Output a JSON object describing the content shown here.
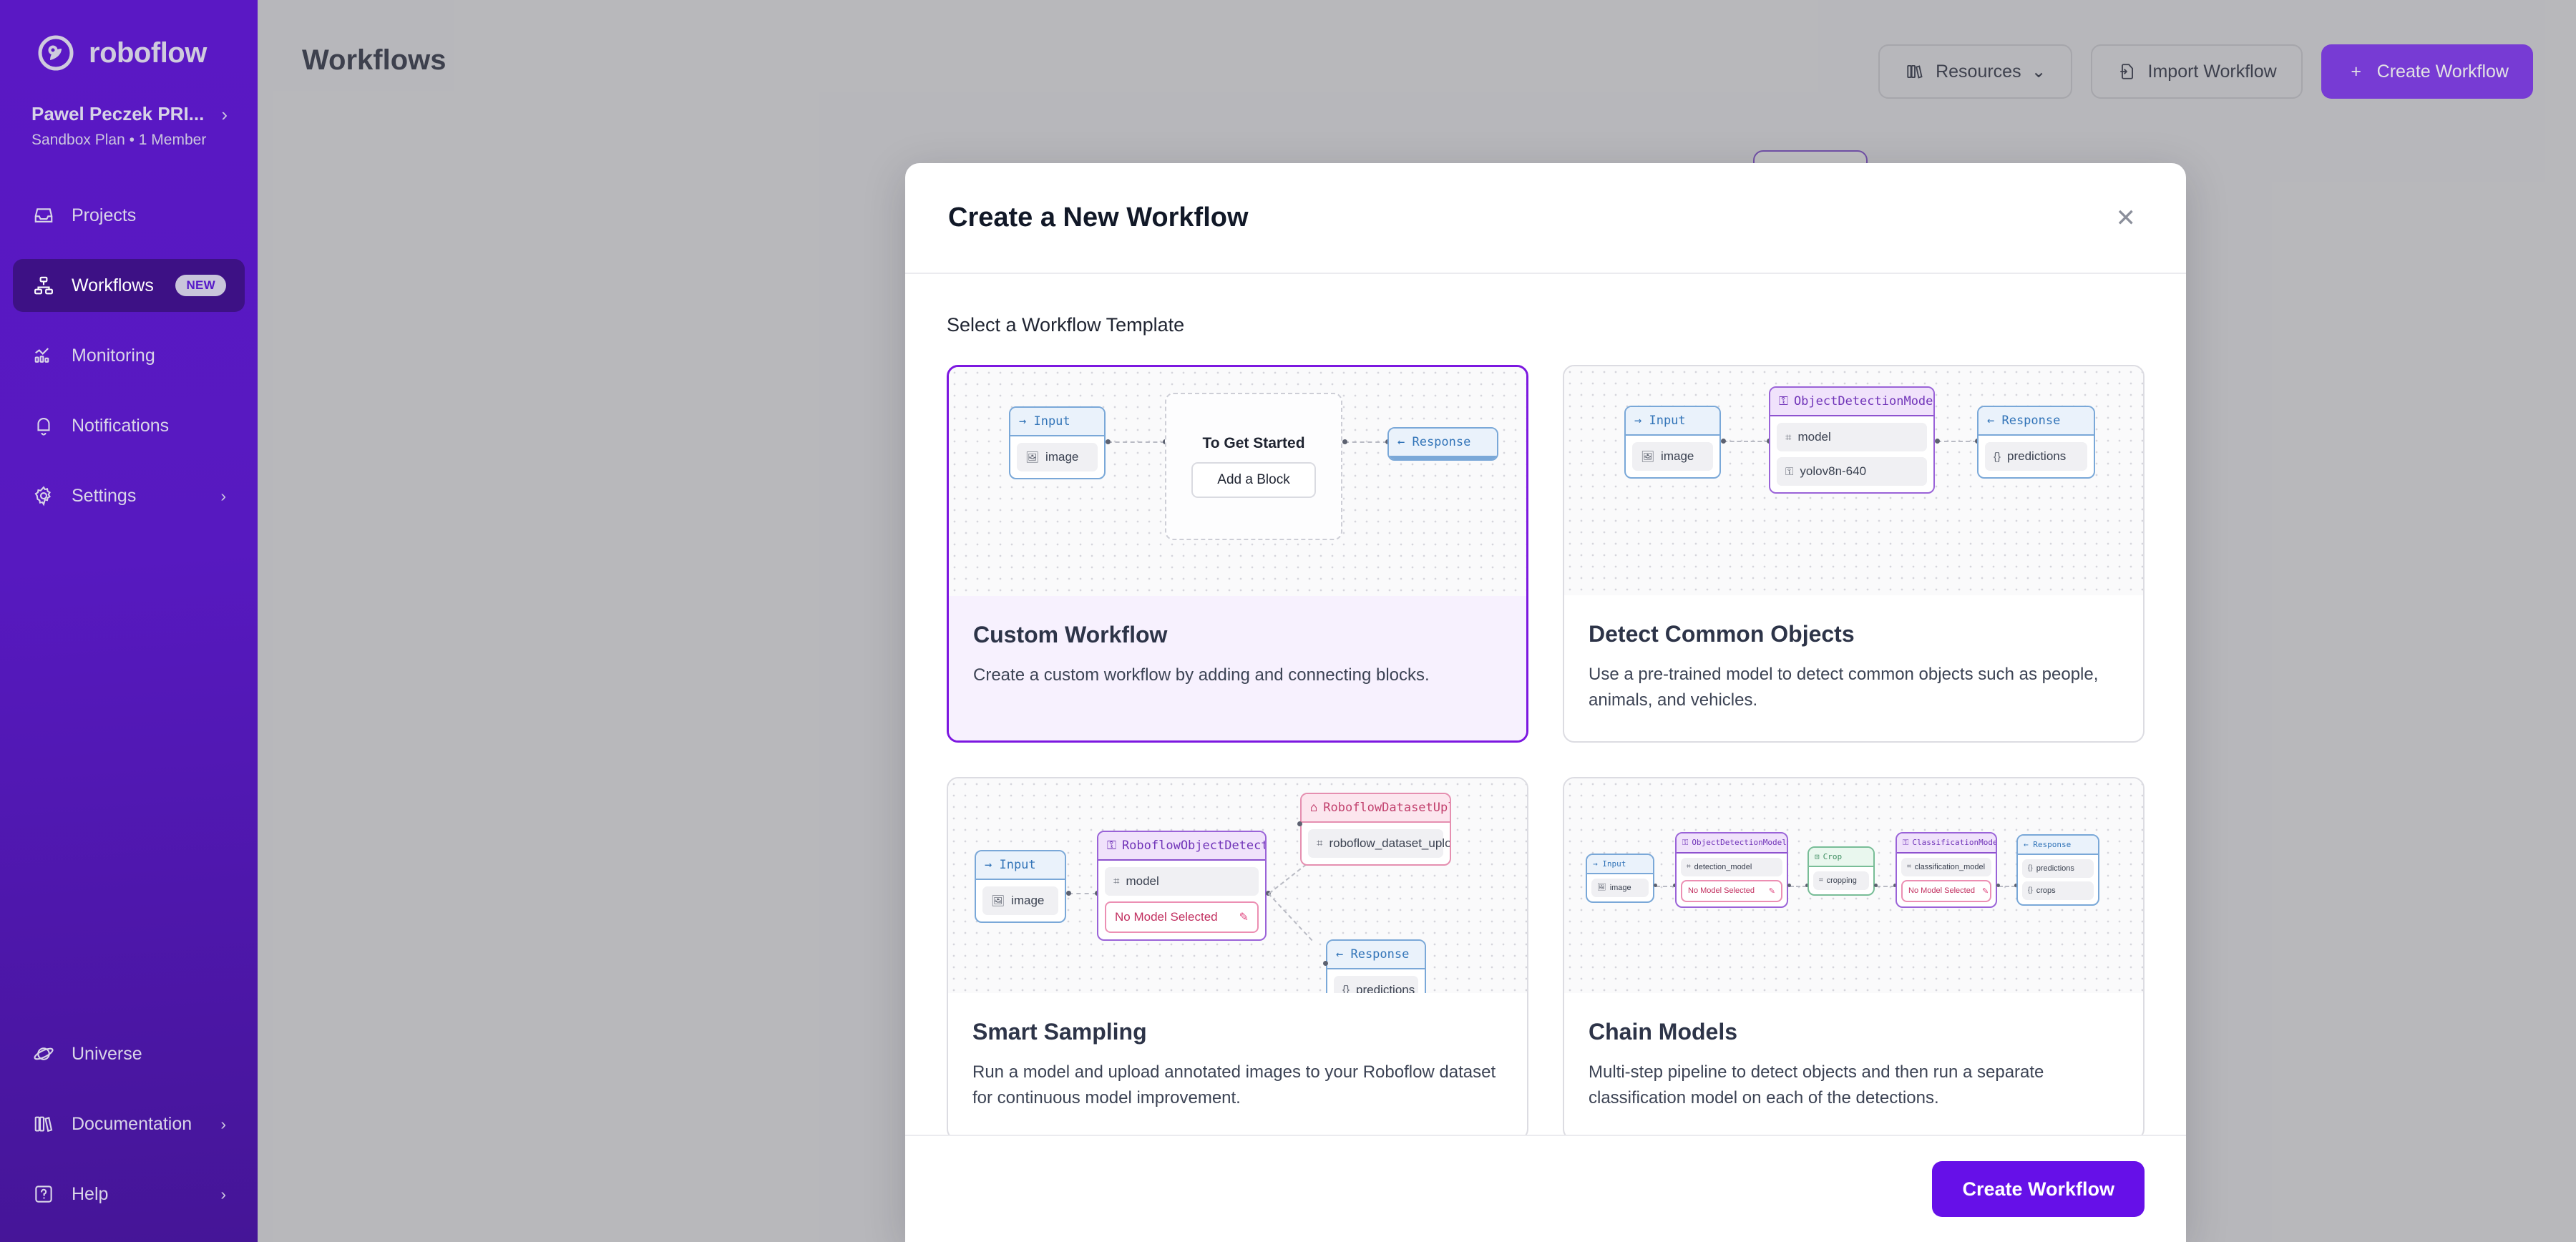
{
  "sidebar": {
    "brand": "roboflow",
    "org_name": "Pawel Peczek PRI...",
    "org_sub": "Sandbox Plan  •  1 Member",
    "items": [
      {
        "label": "Projects",
        "icon": "inbox-icon",
        "badge": "",
        "chevron": ""
      },
      {
        "label": "Workflows",
        "icon": "workflow-icon",
        "badge": "NEW",
        "chevron": ""
      },
      {
        "label": "Monitoring",
        "icon": "chart-icon",
        "badge": "",
        "chevron": ""
      },
      {
        "label": "Notifications",
        "icon": "bell-icon",
        "badge": "",
        "chevron": ""
      },
      {
        "label": "Settings",
        "icon": "gear-icon",
        "badge": "",
        "chevron": "›"
      }
    ],
    "bottom_items": [
      {
        "label": "Universe",
        "icon": "planet-icon",
        "chevron": ""
      },
      {
        "label": "Documentation",
        "icon": "books-icon",
        "chevron": "›"
      },
      {
        "label": "Help",
        "icon": "question-box-icon",
        "chevron": "›"
      }
    ]
  },
  "header": {
    "title": "Workflows",
    "resources_label": "Resources",
    "resources_caret": "⌄",
    "import_label": "Import Workflow",
    "create_label": "Create Workflow",
    "create_plus": "+"
  },
  "modal": {
    "title": "Create a New Workflow",
    "close": "✕",
    "section_label": "Select a Workflow Template",
    "footer_button": "Create Workflow",
    "templates": [
      {
        "name": "Custom Workflow",
        "description": "Create a custom workflow by adding and connecting blocks.",
        "selected": true,
        "nodes": {
          "input_head": "→ Input",
          "input_chip": "image",
          "empty_title": "To Get Started",
          "empty_button": "Add a Block",
          "response_head": "← Response"
        }
      },
      {
        "name": "Detect Common Objects",
        "description": "Use a pre-trained model to detect common objects such as people, animals, and vehicles.",
        "selected": false,
        "nodes": {
          "input_head": "→ Input",
          "input_chip": "image",
          "model_head": "ObjectDetectionModel",
          "model_chip": "model",
          "model_value": "yolov8n-640",
          "response_head": "← Response",
          "response_chip": "predictions"
        }
      },
      {
        "name": "Smart Sampling",
        "description": "Run a model and upload annotated images to your Roboflow dataset for continuous model improvement.",
        "selected": false,
        "nodes": {
          "input_head": "→ Input",
          "input_chip": "image",
          "model_head": "RoboflowObjectDetectionModel",
          "model_chip": "model",
          "model_warn": "No Model Selected",
          "upload_head": "RoboflowDatasetUpload",
          "upload_chip": "roboflow_dataset_upload",
          "response_head": "← Response",
          "response_chip": "predictions"
        }
      },
      {
        "name": "Chain Models",
        "description": "Multi-step pipeline to detect objects and then run a separate classification model on each of the detections.",
        "selected": false,
        "nodes": {
          "input_head": "→ Input",
          "input_chip": "image",
          "det_head": "ObjectDetectionModel",
          "det_chip": "detection_model",
          "det_warn": "No Model Selected",
          "crop_head": "Crop",
          "crop_chip": "cropping",
          "cls_head": "ClassificationModel",
          "cls_chip": "classification_model",
          "cls_warn": "No Model Selected",
          "response_head": "← Response",
          "response_chip1": "predictions",
          "response_chip2": "crops"
        }
      }
    ]
  },
  "colors": {
    "brand_purple": "#6610e8",
    "sidebar_purple": "#5719c0",
    "selected_border": "#7c17e0",
    "node_blue": "#3274b8",
    "node_purple": "#7033b8",
    "node_pink": "#c2416e",
    "node_green": "#3f8f62"
  }
}
